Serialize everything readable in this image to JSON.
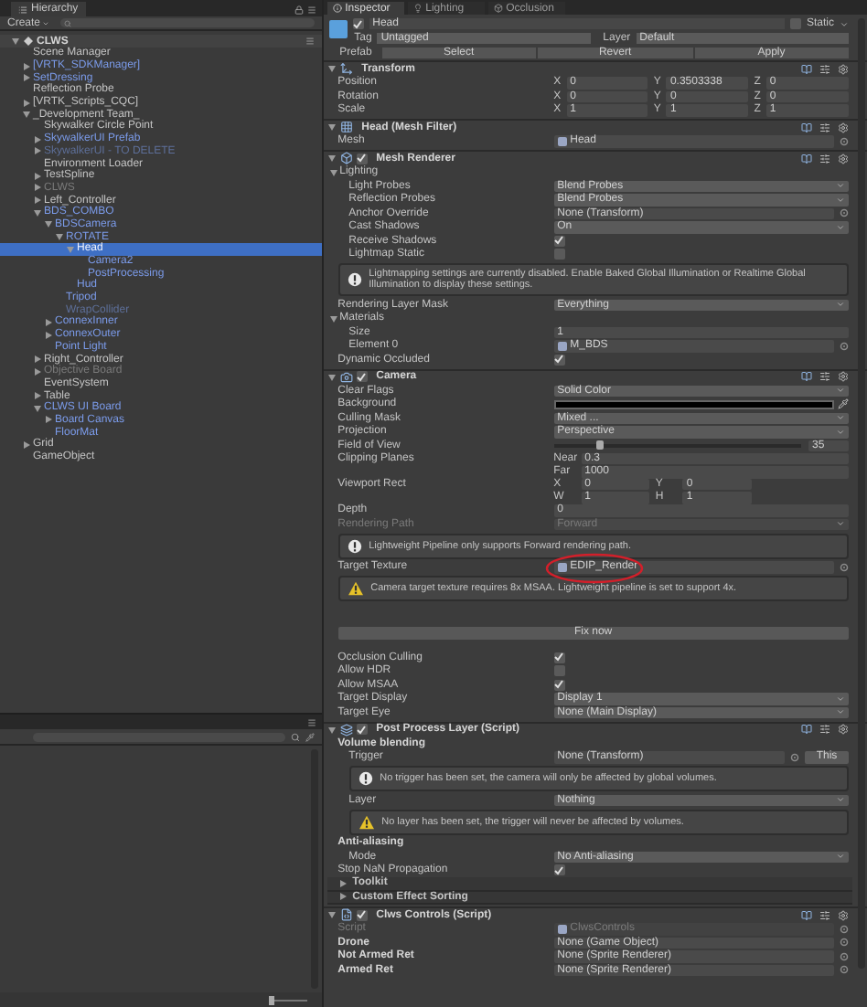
{
  "lower_panel": {
    "zoom": {
      "level": 0
    }
  },
  "hierarchy": {
    "tab": "Hierarchy",
    "create": "Create",
    "scene": {
      "name": "CLWS",
      "expanded": true,
      "children": [
        {
          "name": "Scene Manager",
          "kind": "object",
          "selected": false
        },
        {
          "name": "[VRTK_SDKManager]",
          "kind": "prefab",
          "selected": false,
          "expanded": false
        },
        {
          "name": "SetDressing",
          "kind": "prefab",
          "selected": false,
          "expanded": false
        },
        {
          "name": "Reflection Probe",
          "kind": "object",
          "selected": false
        },
        {
          "name": "[VRTK_Scripts_CQC]",
          "kind": "object",
          "selected": false,
          "expanded": false
        },
        {
          "name": "_Development Team_",
          "kind": "object",
          "selected": false,
          "expanded": true,
          "children": [
            {
              "name": "Skywalker Circle Point",
              "kind": "object",
              "selected": false
            },
            {
              "name": "SkywalkerUI Prefab",
              "kind": "prefab",
              "selected": false,
              "expanded": false
            },
            {
              "name": "SkywalkerUI - TO DELETE",
              "kind": "inactive_prefab",
              "selected": false,
              "expanded": false
            },
            {
              "name": "Environment Loader",
              "kind": "object",
              "selected": false
            },
            {
              "name": "TestSpline",
              "kind": "object",
              "selected": false,
              "expanded": false
            },
            {
              "name": "CLWS",
              "kind": "inactive",
              "selected": false,
              "expanded": false
            },
            {
              "name": "Left_Controller",
              "kind": "object",
              "selected": false,
              "expanded": false
            },
            {
              "name": "BDS_COMBO",
              "kind": "prefab",
              "selected": false,
              "expanded": true,
              "children": [
                {
                  "name": "BDSCamera",
                  "kind": "prefab",
                  "selected": false,
                  "expanded": true,
                  "children": [
                    {
                      "name": "ROTATE",
                      "kind": "prefab",
                      "selected": false,
                      "expanded": true,
                      "children": [
                        {
                          "name": "Head",
                          "kind": "prefab",
                          "selected": true,
                          "expanded": true,
                          "children": [
                            {
                              "name": "Camera2",
                              "kind": "prefab",
                              "selected": false
                            },
                            {
                              "name": "PostProcessing",
                              "kind": "prefab",
                              "selected": false
                            }
                          ]
                        },
                        {
                          "name": "Hud",
                          "kind": "prefab",
                          "selected": false
                        }
                      ]
                    },
                    {
                      "name": "Tripod",
                      "kind": "prefab",
                      "selected": false
                    },
                    {
                      "name": "WrapCollider",
                      "kind": "inactive_prefab",
                      "selected": false
                    }
                  ]
                },
                {
                  "name": "ConnexInner",
                  "kind": "prefab",
                  "selected": false,
                  "expanded": false
                },
                {
                  "name": "ConnexOuter",
                  "kind": "prefab",
                  "selected": false,
                  "expanded": false
                },
                {
                  "name": "Point Light",
                  "kind": "prefab",
                  "selected": false
                }
              ]
            },
            {
              "name": "Right_Controller",
              "kind": "object",
              "selected": false,
              "expanded": false
            },
            {
              "name": "Objective Board",
              "kind": "inactive",
              "selected": false,
              "expanded": false
            },
            {
              "name": "EventSystem",
              "kind": "object",
              "selected": false
            },
            {
              "name": "Table",
              "kind": "object",
              "selected": false,
              "expanded": false
            },
            {
              "name": "CLWS UI Board",
              "kind": "prefab",
              "selected": false,
              "expanded": true,
              "children": [
                {
                  "name": "Board Canvas",
                  "kind": "prefab",
                  "selected": false,
                  "expanded": false
                },
                {
                  "name": "FloorMat",
                  "kind": "prefab",
                  "selected": false
                }
              ]
            }
          ]
        },
        {
          "name": "Grid",
          "kind": "object",
          "selected": false,
          "expanded": false
        },
        {
          "name": "GameObject",
          "kind": "object",
          "selected": false
        }
      ]
    }
  },
  "inspector": {
    "tabs": [
      {
        "label": "Inspector",
        "selected": true
      },
      {
        "label": "Lighting",
        "selected": false
      },
      {
        "label": "Occlusion",
        "selected": false
      }
    ],
    "object": {
      "active": true,
      "name": "Head",
      "static_label": "Static",
      "static": false,
      "tag_label": "Tag",
      "tag": "Untagged",
      "layer_label": "Layer",
      "layer": "Default",
      "prefab_label": "Prefab",
      "prefab_buttons": [
        "Select",
        "Revert",
        "Apply"
      ]
    },
    "components": [
      {
        "kind": "transform",
        "title": "Transform",
        "expanded": true,
        "rows": [
          {
            "kind": "vector",
            "label": "Position",
            "fields": [
              {
                "axis": "X",
                "value": "0"
              },
              {
                "axis": "Y",
                "value": "0.3503338"
              },
              {
                "axis": "Z",
                "value": "0"
              }
            ]
          },
          {
            "kind": "vector",
            "label": "Rotation",
            "fields": [
              {
                "axis": "X",
                "value": "0"
              },
              {
                "axis": "Y",
                "value": "0"
              },
              {
                "axis": "Z",
                "value": "0"
              }
            ]
          },
          {
            "kind": "vector",
            "label": "Scale",
            "fields": [
              {
                "axis": "X",
                "value": "1"
              },
              {
                "axis": "Y",
                "value": "1"
              },
              {
                "axis": "Z",
                "value": "1"
              }
            ]
          }
        ]
      },
      {
        "kind": "mesh_filter",
        "title": "Head (Mesh Filter)",
        "expanded": true,
        "rows": [
          {
            "kind": "asset",
            "label": "Mesh",
            "value": "Head"
          }
        ]
      },
      {
        "kind": "mesh_renderer",
        "title": "Mesh Renderer",
        "enabled": true,
        "expanded": true,
        "rows": [
          {
            "kind": "section",
            "label": "Lighting",
            "expanded": true,
            "rows": [
              {
                "kind": "dropdown",
                "label": "Light Probes",
                "value": "Blend Probes"
              },
              {
                "kind": "dropdown",
                "label": "Reflection Probes",
                "value": "Blend Probes"
              },
              {
                "kind": "object",
                "label": "Anchor Override",
                "value": "None (Transform)"
              },
              {
                "kind": "dropdown",
                "label": "Cast Shadows",
                "value": "On"
              },
              {
                "kind": "check",
                "label": "Receive Shadows",
                "checked": true
              },
              {
                "kind": "check",
                "label": "Lightmap Static",
                "checked": false
              }
            ]
          },
          {
            "kind": "info",
            "text": "Lightmapping settings are currently disabled. Enable Baked Global Illumination or Realtime Global Illumination to display these settings."
          },
          {
            "kind": "dropdown",
            "label": "Rendering Layer Mask",
            "value": "Everything"
          },
          {
            "kind": "section",
            "label": "Materials",
            "expanded": true,
            "rows": [
              {
                "kind": "number",
                "label": "Size",
                "value": "1"
              },
              {
                "kind": "asset",
                "label": "Element 0",
                "value": "M_BDS"
              }
            ]
          },
          {
            "kind": "check",
            "label": "Dynamic Occluded",
            "checked": true
          }
        ]
      },
      {
        "kind": "camera",
        "title": "Camera",
        "enabled": true,
        "expanded": true,
        "rows": [
          {
            "kind": "dropdown",
            "label": "Clear Flags",
            "value": "Solid Color"
          },
          {
            "kind": "color",
            "label": "Background",
            "color": "#000000"
          },
          {
            "kind": "dropdown",
            "label": "Culling Mask",
            "value": "Mixed ..."
          },
          {
            "kind": "dropdown",
            "label": "Projection",
            "value": "Perspective"
          },
          {
            "kind": "slider",
            "label": "Field of View",
            "level": 0.19,
            "value": "35"
          },
          {
            "kind": "stack",
            "label": "Clipping Planes",
            "fields": [
              {
                "axis": "Near",
                "value": "0.3"
              },
              {
                "axis": "Far",
                "value": "1000"
              }
            ]
          },
          {
            "kind": "rect",
            "label": "Viewport Rect",
            "fields": [
              {
                "axis": "X",
                "value": "0"
              },
              {
                "axis": "Y",
                "value": "0"
              },
              {
                "axis": "W",
                "value": "1"
              },
              {
                "axis": "H",
                "value": "1"
              }
            ]
          },
          {
            "kind": "number",
            "label": "Depth",
            "value": "0"
          },
          {
            "kind": "dropdown",
            "label": "Rendering Path",
            "value": "Forward",
            "disabled": true
          },
          {
            "kind": "info",
            "text": "Lightweight Pipeline only supports Forward rendering path."
          },
          {
            "kind": "asset",
            "label": "Target Texture",
            "value": "EDIP_Render",
            "circled": true
          },
          {
            "kind": "warning",
            "text": "Camera target texture requires 8x MSAA. Lightweight pipeline is set to support 4x."
          },
          {
            "kind": "button",
            "label": "Fix now"
          },
          {
            "kind": "check",
            "label": "Occlusion Culling",
            "checked": true
          },
          {
            "kind": "check",
            "label": "Allow HDR",
            "checked": false
          },
          {
            "kind": "check",
            "label": "Allow MSAA",
            "checked": true
          },
          {
            "kind": "dropdown",
            "label": "Target Display",
            "value": "Display 1"
          },
          {
            "kind": "dropdown",
            "label": "Target Eye",
            "value": "None (Main Display)"
          }
        ]
      },
      {
        "kind": "post_process",
        "title": "Post Process Layer (Script)",
        "enabled": true,
        "expanded": true,
        "rows": [
          {
            "kind": "heading",
            "label": "Volume blending",
            "rows": [
              {
                "kind": "object",
                "label": "Trigger",
                "value": "None (Transform)",
                "button": "This"
              },
              {
                "kind": "info",
                "text": "No trigger has been set, the camera will only be affected by global volumes."
              },
              {
                "kind": "dropdown",
                "label": "Layer",
                "value": "Nothing"
              },
              {
                "kind": "warning",
                "text": "No layer has been set, the trigger will never be affected by volumes."
              }
            ]
          },
          {
            "kind": "heading",
            "label": "Anti-aliasing",
            "rows": [
              {
                "kind": "dropdown",
                "label": "Mode",
                "value": "No Anti-aliasing"
              }
            ]
          },
          {
            "kind": "check",
            "label": "Stop NaN Propagation",
            "checked": true
          },
          {
            "kind": "foldout",
            "label": "Toolkit",
            "expanded": false
          },
          {
            "kind": "foldout",
            "label": "Custom Effect Sorting",
            "expanded": false
          }
        ]
      },
      {
        "kind": "script",
        "title": "Clws Controls (Script)",
        "enabled": true,
        "expanded": true,
        "rows": [
          {
            "kind": "asset",
            "label": "Script",
            "value": "ClwsControls",
            "disabled": true
          },
          {
            "kind": "object",
            "label": "Drone",
            "value": "None (Game Object)",
            "bold": true
          },
          {
            "kind": "object",
            "label": "Not Armed Ret",
            "value": "None (Sprite Renderer)",
            "bold": true
          },
          {
            "kind": "object",
            "label": "Armed Ret",
            "value": "None (Sprite Renderer)",
            "bold": true
          }
        ]
      }
    ]
  }
}
